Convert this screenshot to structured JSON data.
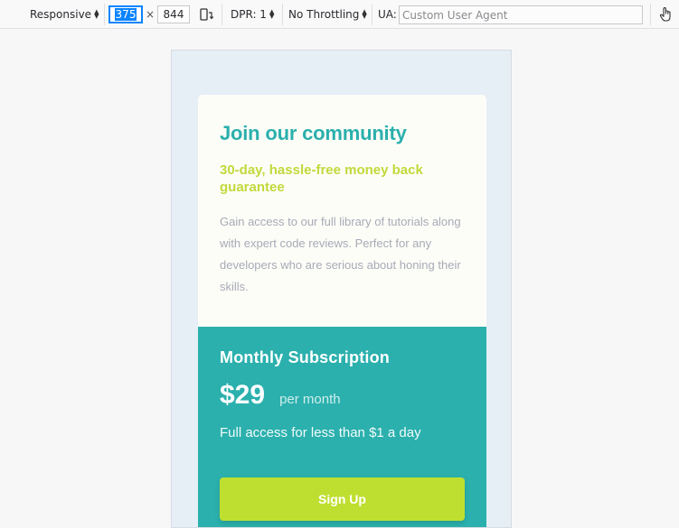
{
  "toolbar": {
    "device_mode": "Responsive",
    "width_value": "375",
    "times_symbol": "×",
    "height_value": "844",
    "rotate_icon": "rotate-device-icon",
    "dpr_label": "DPR: 1",
    "throttling": "No Throttling",
    "ua_label": "UA:",
    "ua_placeholder": "Custom User Agent",
    "touch_icon": "touch-simulation-icon",
    "accent_color": "#0a84ff"
  },
  "page": {
    "title": "Join our community",
    "guarantee": "30-day, hassle-free money back guarantee",
    "description": "Gain access to our full library of tutorials along with expert code reviews. Perfect for any developers who are serious about honing their skills.",
    "subscription_title": "Monthly Subscription",
    "price": "$29",
    "per_month": "per month",
    "access_text": "Full access for less than $1 a day",
    "signup_label": "Sign Up",
    "colors": {
      "teal": "#2bb0ad",
      "lime": "#bfdf30",
      "background": "#e6eef6",
      "card": "#fdfdf8"
    }
  }
}
